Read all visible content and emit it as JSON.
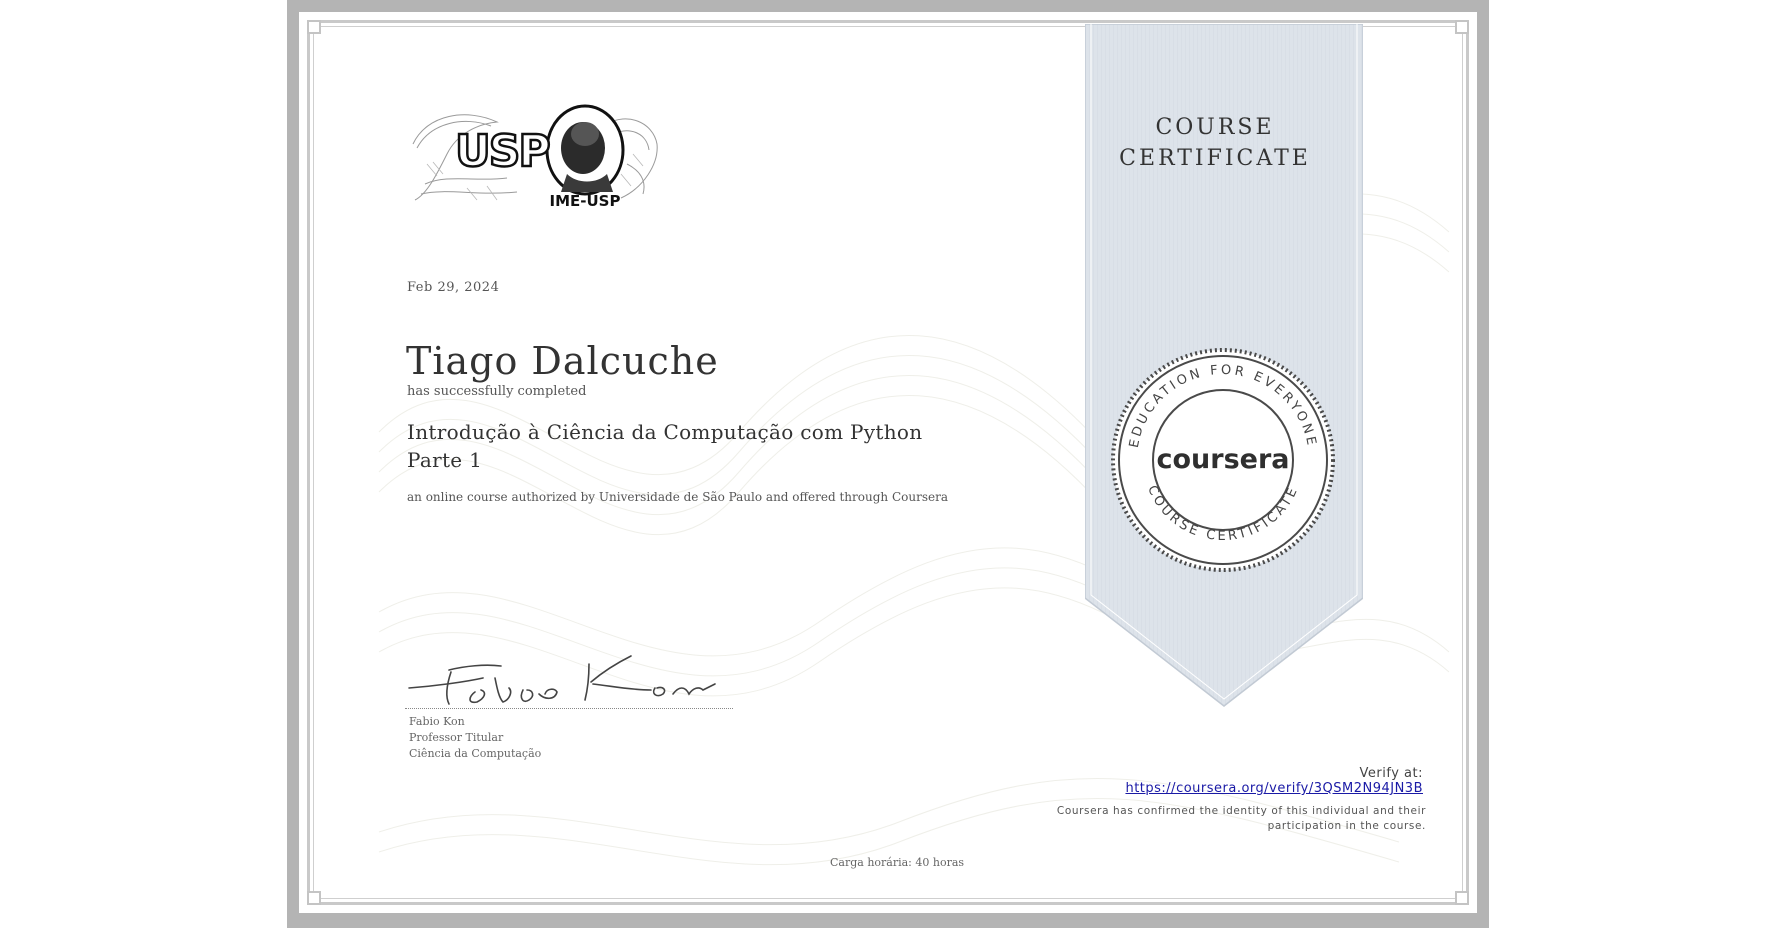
{
  "certificate": {
    "logo_text_usp": "USP",
    "logo_text_ime": "IME-USP",
    "date": "Feb 29, 2024",
    "recipient_name": "Tiago Dalcuche",
    "completed_text": "has successfully completed",
    "course_title_line1": "Introdução à Ciência da Computação com Python",
    "course_title_line2": "Parte 1",
    "authorization_text": "an online course authorized by Universidade de São Paulo and offered through Coursera",
    "carga_horaria": "Carga horária: 40 horas"
  },
  "signature": {
    "name": "Fabio Kon",
    "title": "Professor Titular",
    "department": "Ciência da Computação",
    "handwriting": "Fabio Kon"
  },
  "ribbon": {
    "title_line1": "COURSE",
    "title_line2": "CERTIFICATE",
    "color": "#dde3ea"
  },
  "seal": {
    "brand": "coursera",
    "top_arc_text": "EDUCATION FOR EVERYONE",
    "bottom_arc_text": "COURSE CERTIFICATE"
  },
  "verification": {
    "label": "Verify at:",
    "url": "https://coursera.org/verify/3QSM2N94JN3B",
    "confirm_line1": "Coursera has confirmed the identity of this individual and their",
    "confirm_line2": "participation in the course."
  },
  "colors": {
    "frame_gray": "#b4b4b4",
    "link_blue": "#1a1aa6",
    "text_dark": "#333333"
  }
}
